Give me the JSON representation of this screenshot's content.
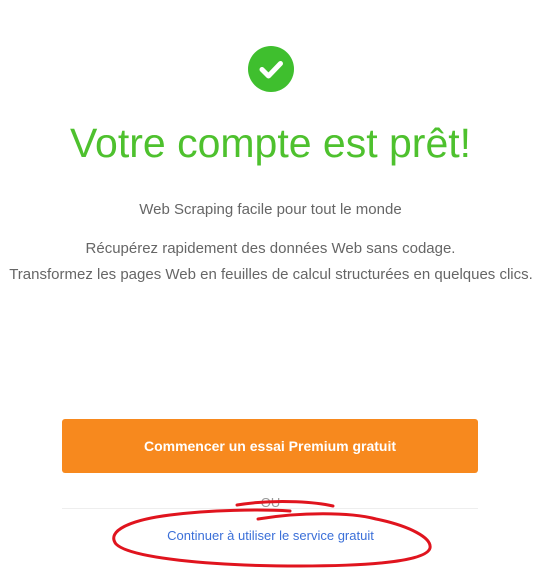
{
  "header": {
    "icon": "check-circle-icon",
    "title": "Votre compte est prêt!",
    "subtitle": "Web Scraping facile pour tout le monde"
  },
  "description": {
    "line1": "Récupérez rapidement des données Web sans codage.",
    "line2": "Transformez les pages Web en feuilles de calcul structurées en quelques clics."
  },
  "actions": {
    "premium_label": "Commencer un essai Premium gratuit",
    "separator": "OU",
    "free_label": "Continuer à utiliser le service gratuit"
  },
  "colors": {
    "success_green": "#3fbf2e",
    "title_green": "#4ec12e",
    "button_orange": "#f7891e",
    "link_blue": "#3a6fd8",
    "annotation_red": "#e0141e"
  }
}
